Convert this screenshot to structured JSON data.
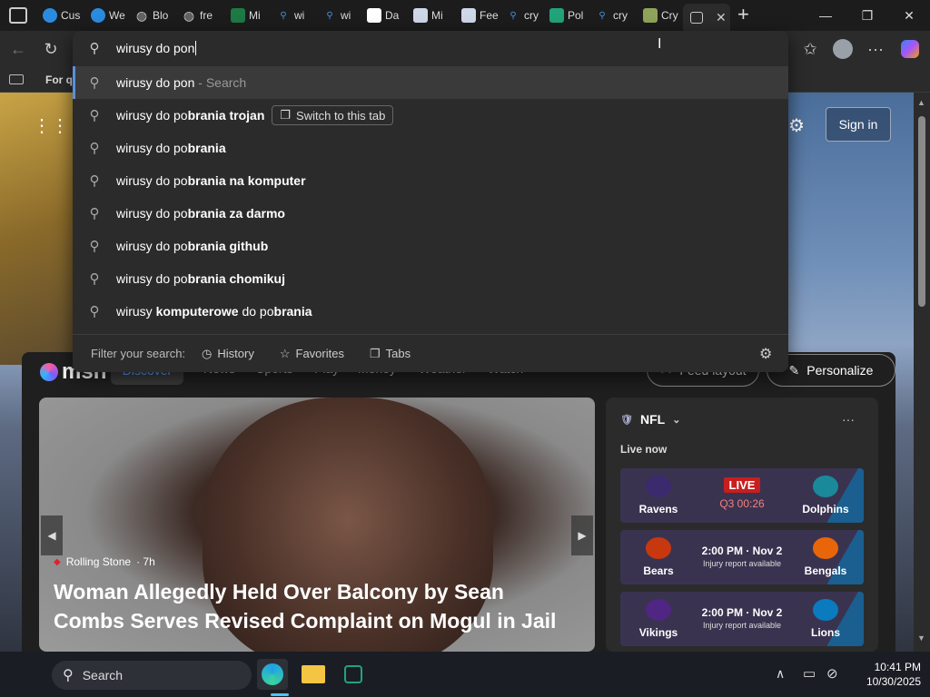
{
  "tabs": [
    {
      "label": "Cus",
      "icon": "edge-icon",
      "color": "#2a8cdf"
    },
    {
      "label": "We",
      "icon": "edge-icon",
      "color": "#2a8cdf"
    },
    {
      "label": "Blo",
      "icon": "globe-icon",
      "color": "#cccccc"
    },
    {
      "label": "fre",
      "icon": "globe-icon",
      "color": "#cccccc"
    },
    {
      "label": "Mi",
      "icon": "excel-icon",
      "color": "#1d7a44"
    },
    {
      "label": "wi",
      "icon": "search-icon",
      "color": "#4a90d9"
    },
    {
      "label": "wi",
      "icon": "search-icon",
      "color": "#4a90d9"
    },
    {
      "label": "Da",
      "icon": "github-icon",
      "color": "#ffffff"
    },
    {
      "label": "Mi",
      "icon": "document-icon",
      "color": "#cfd8e8"
    },
    {
      "label": "Fee",
      "icon": "document-icon",
      "color": "#cfd8e8"
    },
    {
      "label": "cry",
      "icon": "search-icon",
      "color": "#4a90d9"
    },
    {
      "label": "Pol",
      "icon": "app-icon",
      "color": "#22a37a"
    },
    {
      "label": "cry",
      "icon": "search-icon",
      "color": "#4a90d9"
    },
    {
      "label": "Cry",
      "icon": "cube-icon",
      "color": "#8fa45a"
    }
  ],
  "omnibox": {
    "value": "wirusy do pon"
  },
  "suggestions": [
    {
      "prefix": "wirusy do pon",
      "bold": "",
      "suffix": "",
      "hint": " - Search",
      "selected": true
    },
    {
      "prefix": "wirusy do po",
      "bold": "brania trojan",
      "suffix": "",
      "hint": "",
      "switch": "Switch to this tab"
    },
    {
      "prefix": "wirusy do po",
      "bold": "brania",
      "suffix": "",
      "hint": ""
    },
    {
      "prefix": "wirusy do po",
      "bold": "brania na komputer",
      "suffix": "",
      "hint": ""
    },
    {
      "prefix": "wirusy do po",
      "bold": "brania za darmo",
      "suffix": "",
      "hint": ""
    },
    {
      "prefix": "wirusy do po",
      "bold": "brania github",
      "suffix": "",
      "hint": ""
    },
    {
      "prefix": "wirusy do po",
      "bold": "brania chomikuj",
      "suffix": "",
      "hint": ""
    },
    {
      "prefix": "wirusy ",
      "bold": "komputerowe",
      "suffix": " do po",
      "bold2": "brania",
      "hint": ""
    }
  ],
  "filter": {
    "label": "Filter your search:",
    "history": "History",
    "favorites": "Favorites",
    "tabs": "Tabs"
  },
  "favbar": {
    "item": "For q"
  },
  "msn": {
    "logo": "msn",
    "nav": [
      "Discover",
      "News",
      "Sports",
      "Play",
      "Money",
      "Weather",
      "Watch"
    ],
    "more": "···",
    "feed_layout": "Feed layout",
    "personalize": "Personalize",
    "sign_in": "Sign in"
  },
  "hero": {
    "source": "Rolling Stone",
    "age": "· 7h",
    "headline": "Woman Allegedly Held Over Balcony by Sean Combs Serves Revised Complaint on Mogul in Jail"
  },
  "nfl": {
    "title": "NFL",
    "live_now": "Live now",
    "games": [
      {
        "home": "Ravens",
        "away": "Dolphins",
        "status": "LIVE",
        "detail": "Q3 00:26",
        "home_color": "#3b2a6e",
        "away_color": "#1a8a9a"
      },
      {
        "home": "Bears",
        "away": "Bengals",
        "status": "2:00 PM · Nov 2",
        "detail": "Injury report available",
        "home_color": "#c8380f",
        "away_color": "#e8650a"
      },
      {
        "home": "Vikings",
        "away": "Lions",
        "status": "2:00 PM · Nov 2",
        "detail": "Injury report available",
        "home_color": "#4f2683",
        "away_color": "#0a7bbf"
      }
    ]
  },
  "taskbar": {
    "search": "Search",
    "time": "10:41 PM",
    "date": "10/30/2025"
  }
}
